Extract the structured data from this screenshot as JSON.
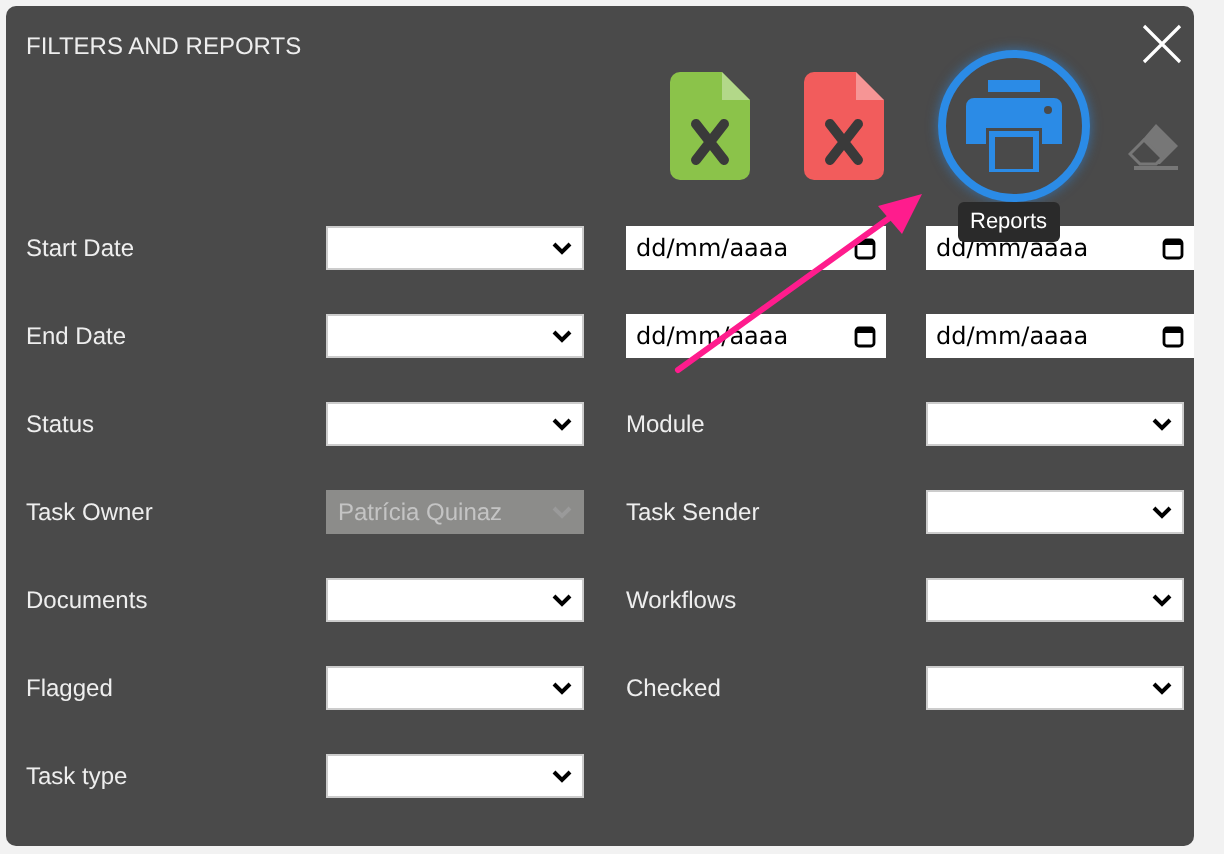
{
  "dialog": {
    "title": "FILTERS AND REPORTS"
  },
  "toolbar": [
    {
      "kind": "file",
      "color": "#8bc34a",
      "highlighted": false
    },
    {
      "kind": "file",
      "color": "#f25c5c",
      "highlighted": false
    },
    {
      "kind": "printer",
      "highlighted": true,
      "tooltip": "Reports"
    },
    {
      "kind": "eraser",
      "highlighted": false
    }
  ],
  "rows": [
    {
      "label": "Start Date",
      "select": {
        "disabled": false
      },
      "dates": [
        {
          "placeholder": "dd/mm/aaaa"
        },
        {
          "placeholder": "dd/mm/aaaa"
        }
      ]
    },
    {
      "label": "End Date",
      "select": {
        "disabled": false
      },
      "dates": [
        {
          "placeholder": "dd/mm/aaaa"
        },
        {
          "placeholder": "dd/mm/aaaa"
        }
      ]
    },
    {
      "label": "Status",
      "select": {
        "disabled": false
      },
      "right": {
        "label": "Module",
        "select": {
          "disabled": false
        }
      }
    },
    {
      "label": "Task Owner",
      "select": {
        "value": "Patrícia Quinaz",
        "disabled": true
      },
      "right": {
        "label": "Task Sender",
        "select": {
          "disabled": false
        }
      }
    },
    {
      "label": "Documents",
      "select": {
        "disabled": false
      },
      "right": {
        "label": "Workflows",
        "select": {
          "disabled": false
        }
      }
    },
    {
      "label": "Flagged",
      "select": {
        "disabled": false
      },
      "right": {
        "label": "Checked",
        "select": {
          "disabled": false
        }
      }
    },
    {
      "label": "Task type",
      "select": {
        "disabled": false
      }
    }
  ]
}
